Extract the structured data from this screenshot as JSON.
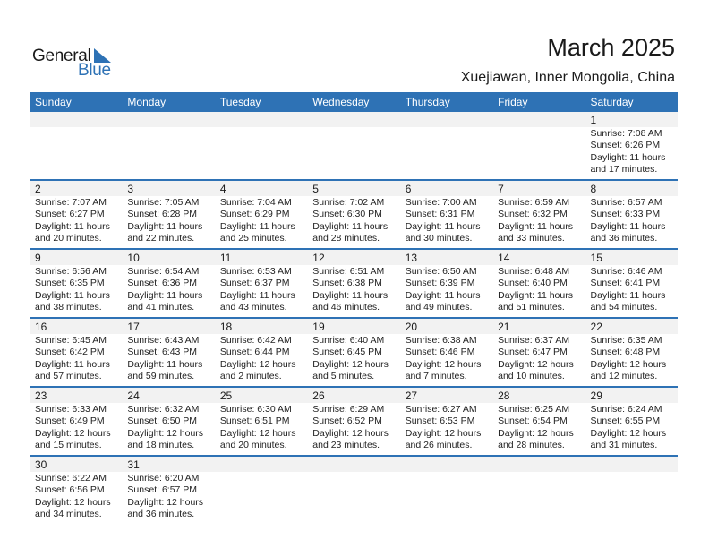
{
  "logo": {
    "line1": "General",
    "line2": "Blue"
  },
  "header": {
    "title": "March 2025",
    "location": "Xuejiawan, Inner Mongolia, China"
  },
  "colors": {
    "accent": "#2e72b5",
    "day_bar": "#f2f2f2"
  },
  "weekdays": [
    "Sunday",
    "Monday",
    "Tuesday",
    "Wednesday",
    "Thursday",
    "Friday",
    "Saturday"
  ],
  "weeks": [
    [
      null,
      null,
      null,
      null,
      null,
      null,
      {
        "day": "1",
        "sunrise": "Sunrise: 7:08 AM",
        "sunset": "Sunset: 6:26 PM",
        "daylight1": "Daylight: 11 hours",
        "daylight2": "and 17 minutes."
      }
    ],
    [
      {
        "day": "2",
        "sunrise": "Sunrise: 7:07 AM",
        "sunset": "Sunset: 6:27 PM",
        "daylight1": "Daylight: 11 hours",
        "daylight2": "and 20 minutes."
      },
      {
        "day": "3",
        "sunrise": "Sunrise: 7:05 AM",
        "sunset": "Sunset: 6:28 PM",
        "daylight1": "Daylight: 11 hours",
        "daylight2": "and 22 minutes."
      },
      {
        "day": "4",
        "sunrise": "Sunrise: 7:04 AM",
        "sunset": "Sunset: 6:29 PM",
        "daylight1": "Daylight: 11 hours",
        "daylight2": "and 25 minutes."
      },
      {
        "day": "5",
        "sunrise": "Sunrise: 7:02 AM",
        "sunset": "Sunset: 6:30 PM",
        "daylight1": "Daylight: 11 hours",
        "daylight2": "and 28 minutes."
      },
      {
        "day": "6",
        "sunrise": "Sunrise: 7:00 AM",
        "sunset": "Sunset: 6:31 PM",
        "daylight1": "Daylight: 11 hours",
        "daylight2": "and 30 minutes."
      },
      {
        "day": "7",
        "sunrise": "Sunrise: 6:59 AM",
        "sunset": "Sunset: 6:32 PM",
        "daylight1": "Daylight: 11 hours",
        "daylight2": "and 33 minutes."
      },
      {
        "day": "8",
        "sunrise": "Sunrise: 6:57 AM",
        "sunset": "Sunset: 6:33 PM",
        "daylight1": "Daylight: 11 hours",
        "daylight2": "and 36 minutes."
      }
    ],
    [
      {
        "day": "9",
        "sunrise": "Sunrise: 6:56 AM",
        "sunset": "Sunset: 6:35 PM",
        "daylight1": "Daylight: 11 hours",
        "daylight2": "and 38 minutes."
      },
      {
        "day": "10",
        "sunrise": "Sunrise: 6:54 AM",
        "sunset": "Sunset: 6:36 PM",
        "daylight1": "Daylight: 11 hours",
        "daylight2": "and 41 minutes."
      },
      {
        "day": "11",
        "sunrise": "Sunrise: 6:53 AM",
        "sunset": "Sunset: 6:37 PM",
        "daylight1": "Daylight: 11 hours",
        "daylight2": "and 43 minutes."
      },
      {
        "day": "12",
        "sunrise": "Sunrise: 6:51 AM",
        "sunset": "Sunset: 6:38 PM",
        "daylight1": "Daylight: 11 hours",
        "daylight2": "and 46 minutes."
      },
      {
        "day": "13",
        "sunrise": "Sunrise: 6:50 AM",
        "sunset": "Sunset: 6:39 PM",
        "daylight1": "Daylight: 11 hours",
        "daylight2": "and 49 minutes."
      },
      {
        "day": "14",
        "sunrise": "Sunrise: 6:48 AM",
        "sunset": "Sunset: 6:40 PM",
        "daylight1": "Daylight: 11 hours",
        "daylight2": "and 51 minutes."
      },
      {
        "day": "15",
        "sunrise": "Sunrise: 6:46 AM",
        "sunset": "Sunset: 6:41 PM",
        "daylight1": "Daylight: 11 hours",
        "daylight2": "and 54 minutes."
      }
    ],
    [
      {
        "day": "16",
        "sunrise": "Sunrise: 6:45 AM",
        "sunset": "Sunset: 6:42 PM",
        "daylight1": "Daylight: 11 hours",
        "daylight2": "and 57 minutes."
      },
      {
        "day": "17",
        "sunrise": "Sunrise: 6:43 AM",
        "sunset": "Sunset: 6:43 PM",
        "daylight1": "Daylight: 11 hours",
        "daylight2": "and 59 minutes."
      },
      {
        "day": "18",
        "sunrise": "Sunrise: 6:42 AM",
        "sunset": "Sunset: 6:44 PM",
        "daylight1": "Daylight: 12 hours",
        "daylight2": "and 2 minutes."
      },
      {
        "day": "19",
        "sunrise": "Sunrise: 6:40 AM",
        "sunset": "Sunset: 6:45 PM",
        "daylight1": "Daylight: 12 hours",
        "daylight2": "and 5 minutes."
      },
      {
        "day": "20",
        "sunrise": "Sunrise: 6:38 AM",
        "sunset": "Sunset: 6:46 PM",
        "daylight1": "Daylight: 12 hours",
        "daylight2": "and 7 minutes."
      },
      {
        "day": "21",
        "sunrise": "Sunrise: 6:37 AM",
        "sunset": "Sunset: 6:47 PM",
        "daylight1": "Daylight: 12 hours",
        "daylight2": "and 10 minutes."
      },
      {
        "day": "22",
        "sunrise": "Sunrise: 6:35 AM",
        "sunset": "Sunset: 6:48 PM",
        "daylight1": "Daylight: 12 hours",
        "daylight2": "and 12 minutes."
      }
    ],
    [
      {
        "day": "23",
        "sunrise": "Sunrise: 6:33 AM",
        "sunset": "Sunset: 6:49 PM",
        "daylight1": "Daylight: 12 hours",
        "daylight2": "and 15 minutes."
      },
      {
        "day": "24",
        "sunrise": "Sunrise: 6:32 AM",
        "sunset": "Sunset: 6:50 PM",
        "daylight1": "Daylight: 12 hours",
        "daylight2": "and 18 minutes."
      },
      {
        "day": "25",
        "sunrise": "Sunrise: 6:30 AM",
        "sunset": "Sunset: 6:51 PM",
        "daylight1": "Daylight: 12 hours",
        "daylight2": "and 20 minutes."
      },
      {
        "day": "26",
        "sunrise": "Sunrise: 6:29 AM",
        "sunset": "Sunset: 6:52 PM",
        "daylight1": "Daylight: 12 hours",
        "daylight2": "and 23 minutes."
      },
      {
        "day": "27",
        "sunrise": "Sunrise: 6:27 AM",
        "sunset": "Sunset: 6:53 PM",
        "daylight1": "Daylight: 12 hours",
        "daylight2": "and 26 minutes."
      },
      {
        "day": "28",
        "sunrise": "Sunrise: 6:25 AM",
        "sunset": "Sunset: 6:54 PM",
        "daylight1": "Daylight: 12 hours",
        "daylight2": "and 28 minutes."
      },
      {
        "day": "29",
        "sunrise": "Sunrise: 6:24 AM",
        "sunset": "Sunset: 6:55 PM",
        "daylight1": "Daylight: 12 hours",
        "daylight2": "and 31 minutes."
      }
    ],
    [
      {
        "day": "30",
        "sunrise": "Sunrise: 6:22 AM",
        "sunset": "Sunset: 6:56 PM",
        "daylight1": "Daylight: 12 hours",
        "daylight2": "and 34 minutes."
      },
      {
        "day": "31",
        "sunrise": "Sunrise: 6:20 AM",
        "sunset": "Sunset: 6:57 PM",
        "daylight1": "Daylight: 12 hours",
        "daylight2": "and 36 minutes."
      },
      null,
      null,
      null,
      null,
      null
    ]
  ]
}
